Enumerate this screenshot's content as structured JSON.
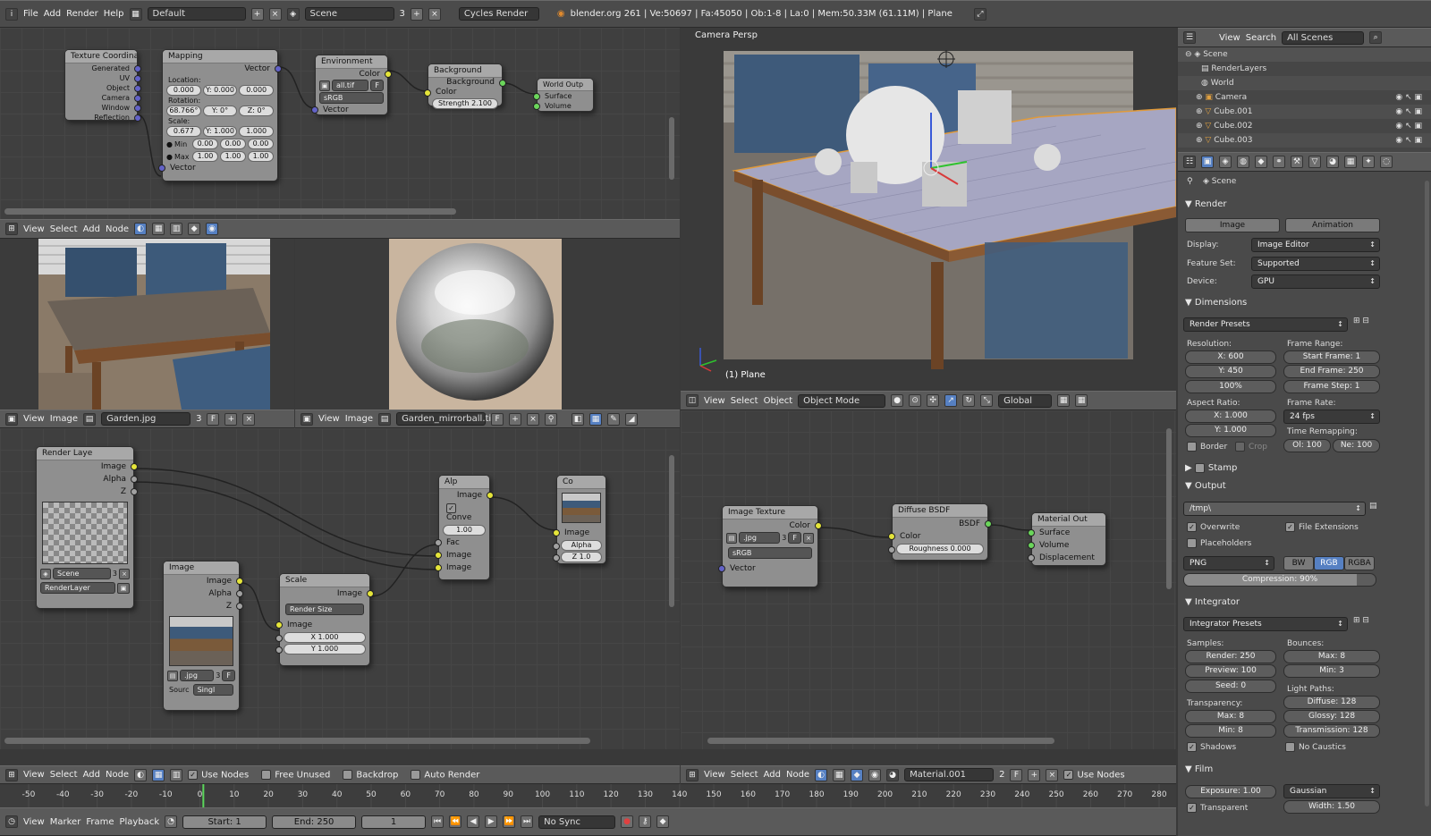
{
  "topbar": {
    "menus": [
      "File",
      "Add",
      "Render",
      "Help"
    ],
    "screen_layout": "Default",
    "scene": "Scene",
    "scene_count": "3",
    "engine": "Cycles Render",
    "info": "blender.org 261 | Ve:50697 | Fa:45050 | Ob:1-8 | La:0 | Mem:50.33M (61.11M) | Plane"
  },
  "world_nodes": {
    "texcoord": {
      "title": "Texture Coordina",
      "outputs": [
        "Generated",
        "UV",
        "Object",
        "Camera",
        "Window",
        "Reflection"
      ]
    },
    "mapping": {
      "title": "Mapping",
      "vector_out": "Vector",
      "location_label": "Location:",
      "location": [
        "0.000",
        "Y: 0.000",
        "0.000"
      ],
      "rotation_label": "Rotation:",
      "rotation": [
        "68.766°",
        "Y: 0°",
        "Z: 0°"
      ],
      "scale_label": "Scale:",
      "scale": [
        "0.677",
        "Y: 1.000",
        "1.000"
      ],
      "min_label": "Min",
      "min": [
        "0.00",
        "0.00",
        "0.00"
      ],
      "max_label": "Max",
      "max": [
        "1.00",
        "1.00",
        "1.00"
      ],
      "vector_in": "Vector"
    },
    "environment": {
      "title": "Environment",
      "color": "Color",
      "image": "all.tif",
      "f": "F",
      "colorspace": "sRGB",
      "vector": "Vector"
    },
    "background": {
      "title": "Background",
      "background": "Background",
      "color": "Color",
      "strength": "Strength 2.100"
    },
    "world_output": {
      "title": "World Outp",
      "surface": "Surface",
      "volume": "Volume"
    }
  },
  "upper_node_header": {
    "menus": [
      "View",
      "Select",
      "Add",
      "Node"
    ]
  },
  "image_editor_left": {
    "menus": [
      "View",
      "Image"
    ],
    "image_name": "Garden.jpg",
    "users": "3",
    "f": "F"
  },
  "image_editor_right": {
    "menus": [
      "View",
      "Image"
    ],
    "image_name": "Garden_mirrorball.tif",
    "f": "F"
  },
  "compositor": {
    "render_layers": {
      "title": "Render Laye",
      "outputs": [
        "Image",
        "Alpha",
        "Z"
      ],
      "scene": "Scene",
      "scene_users": "3",
      "layer": "RenderLayer"
    },
    "image": {
      "title": "Image",
      "outputs": [
        "Image",
        "Alpha",
        "Z"
      ],
      "file": ".jpg",
      "users": "3",
      "f": "F",
      "source_label": "Sourc",
      "source": "Singl"
    },
    "scale": {
      "title": "Scale",
      "image_out": "Image",
      "mode": "Render Size",
      "image_in": "Image",
      "x": "X 1.000",
      "y": "Y 1.000"
    },
    "alpha_over": {
      "title": "Alp",
      "image_out": "Image",
      "convert": "Conve",
      "value": "1.00",
      "fac": "Fac",
      "image1": "Image",
      "image2": "Image"
    },
    "composite": {
      "title": "Co",
      "image": "Image",
      "alpha": "Alpha",
      "z": "Z 1.0"
    }
  },
  "compositor_header": {
    "menus": [
      "View",
      "Select",
      "Add",
      "Node"
    ],
    "use_nodes": "Use Nodes",
    "free_unused": "Free Unused",
    "backdrop": "Backdrop",
    "auto_render": "Auto Render"
  },
  "viewport": {
    "label": "Camera Persp",
    "object_label": "(1) Plane",
    "menus": [
      "View",
      "Select",
      "Object"
    ],
    "mode": "Object Mode",
    "orientation": "Global"
  },
  "material_nodes": {
    "image_texture": {
      "title": "Image Texture",
      "color": "Color",
      "file": ".jpg",
      "users": "3",
      "f": "F",
      "colorspace": "sRGB",
      "vector": "Vector"
    },
    "diffuse": {
      "title": "Diffuse BSDF",
      "bsdf": "BSDF",
      "color": "Color",
      "roughness": "Roughness 0.000"
    },
    "material_output": {
      "title": "Material Out",
      "surface": "Surface",
      "volume": "Volume",
      "displacement": "Displacement"
    }
  },
  "material_header": {
    "menus": [
      "View",
      "Select",
      "Add",
      "Node"
    ],
    "material": "Material.001",
    "users": "2",
    "f": "F",
    "use_nodes": "Use Nodes"
  },
  "outliner": {
    "menus": [
      "View",
      "Search"
    ],
    "filter": "All Scenes",
    "items": [
      {
        "name": "Scene",
        "icon": "scene-icon"
      },
      {
        "name": "RenderLayers",
        "icon": "renderlayers-icon"
      },
      {
        "name": "World",
        "icon": "world-icon"
      },
      {
        "name": "Camera",
        "icon": "camera-icon"
      },
      {
        "name": "Cube.001",
        "icon": "mesh-icon"
      },
      {
        "name": "Cube.002",
        "icon": "mesh-icon"
      },
      {
        "name": "Cube.003",
        "icon": "mesh-icon"
      }
    ]
  },
  "properties": {
    "context": "Scene",
    "render": {
      "header": "Render",
      "image_btn": "Image",
      "animation_btn": "Animation",
      "display_label": "Display:",
      "display": "Image Editor",
      "feature_label": "Feature Set:",
      "feature": "Supported",
      "device_label": "Device:",
      "device": "GPU"
    },
    "dimensions": {
      "header": "Dimensions",
      "presets": "Render Presets",
      "resolution_label": "Resolution:",
      "res_x": "X: 600",
      "res_y": "Y: 450",
      "res_pct": "100%",
      "frame_range_label": "Frame Range:",
      "start": "Start Frame: 1",
      "end": "End Frame: 250",
      "step": "Frame Step: 1",
      "aspect_label": "Aspect Ratio:",
      "asp_x": "X: 1.000",
      "asp_y": "Y: 1.000",
      "frame_rate_label": "Frame Rate:",
      "fps": "24 fps",
      "remap_label": "Time Remapping:",
      "remap_old": "Ol: 100",
      "remap_new": "Ne: 100",
      "border": "Border",
      "crop": "Crop"
    },
    "stamp": {
      "header": "Stamp"
    },
    "output": {
      "header": "Output",
      "path": "/tmp\\",
      "overwrite": "Overwrite",
      "file_ext": "File Extensions",
      "placeholders": "Placeholders",
      "format": "PNG",
      "bw": "BW",
      "rgb": "RGB",
      "rgba": "RGBA",
      "compression": "Compression: 90%",
      "compression_value": 0.9
    },
    "integrator": {
      "header": "Integrator",
      "presets": "Integrator Presets",
      "samples_label": "Samples:",
      "render": "Render: 250",
      "preview": "Preview: 100",
      "seed": "Seed: 0",
      "bounces_label": "Bounces:",
      "max": "Max: 8",
      "min": "Min: 3",
      "transparency_label": "Transparency:",
      "t_max": "Max: 8",
      "t_min": "Min: 8",
      "light_paths_label": "Light Paths:",
      "diffuse": "Diffuse: 128",
      "glossy": "Glossy: 128",
      "transmission": "Transmission: 128",
      "shadows": "Shadows",
      "no_caustics": "No Caustics"
    },
    "film": {
      "header": "Film",
      "exposure": "Exposure: 1.00",
      "filter": "Gaussian",
      "transparent": "Transparent",
      "width": "Width: 1.50"
    }
  },
  "timeline": {
    "ticks": [
      "-50",
      "-40",
      "-30",
      "-20",
      "-10",
      "0",
      "10",
      "20",
      "30",
      "40",
      "50",
      "60",
      "70",
      "80",
      "90",
      "100",
      "110",
      "120",
      "130",
      "140",
      "150",
      "160",
      "170",
      "180",
      "190",
      "200",
      "210",
      "220",
      "230",
      "240",
      "250",
      "260",
      "270",
      "280"
    ],
    "current_frame": 1,
    "menus": [
      "View",
      "Marker",
      "Frame",
      "Playback"
    ],
    "start": "Start: 1",
    "end": "End: 250",
    "frame": "1",
    "sync": "No Sync"
  }
}
